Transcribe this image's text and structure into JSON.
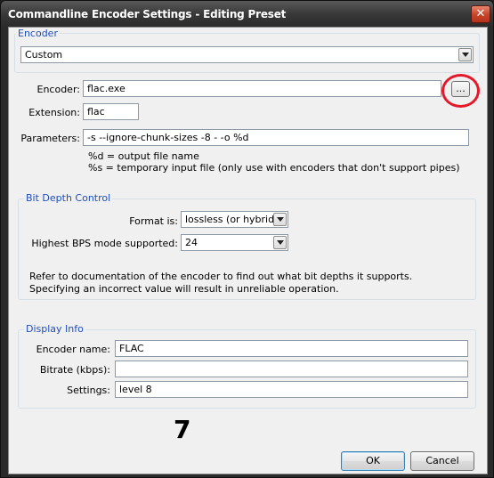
{
  "window": {
    "title": "Commandline Encoder Settings - Editing Preset",
    "close_glyph": "✕"
  },
  "encoder_group": {
    "title": "Encoder",
    "preset_value": "Custom"
  },
  "encoder_fields": {
    "encoder_label": "Encoder:",
    "encoder_value": "flac.exe",
    "browse_label": "...",
    "extension_label": "Extension:",
    "extension_value": "flac",
    "parameters_label": "Parameters:",
    "parameters_value": "-s --ignore-chunk-sizes -8 - -o %d",
    "hint_line1": "%d = output file name",
    "hint_line2": "%s = temporary input file (only use with encoders that don't support pipes)"
  },
  "bit_depth": {
    "title": "Bit Depth Control",
    "format_label": "Format is:",
    "format_value": "lossless (or hybrid)",
    "bps_label": "Highest BPS mode supported:",
    "bps_value": "24",
    "note_line1": "Refer to documentation of the encoder to find out what bit depths it supports.",
    "note_line2": "Specifying an incorrect value will result in unreliable operation."
  },
  "display_info": {
    "title": "Display Info",
    "encoder_name_label": "Encoder name:",
    "encoder_name_value": "FLAC",
    "bitrate_label": "Bitrate (kbps):",
    "bitrate_value": "",
    "settings_label": "Settings:",
    "settings_value": "level 8"
  },
  "annotation": {
    "number": "7",
    "highlight_color": "#e5182a"
  },
  "buttons": {
    "ok": "OK",
    "cancel": "Cancel"
  }
}
